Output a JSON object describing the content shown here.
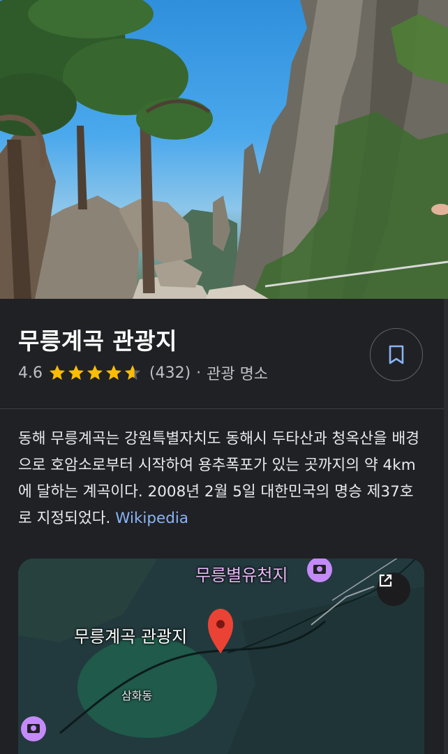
{
  "place": {
    "title": "무릉계곡 관광지",
    "rating": "4.6",
    "rating_value": 4.6,
    "review_count": "(432)",
    "separator": "·",
    "category": "관광 명소"
  },
  "description": {
    "text": "동해 무릉계곡는 강원특별자치도 동해시 두타산과 청옥산을 배경으로 호암소로부터 시작하여 용추폭포가 있는 곳까지의 약 4km에 달하는 계곡이다. 2008년 2월 5일 대한민국의 명승 제37호로 지정되었다. ",
    "link_label": "Wikipedia"
  },
  "map": {
    "place_label": "무릉계곡 관광지",
    "poi_label": "무릉별유천지",
    "district_label": "삼화동"
  },
  "icons": {
    "save": "bookmark-icon",
    "expand": "open-in-new-icon",
    "pin": "map-pin-icon",
    "poi": "camera-icon"
  },
  "colors": {
    "background": "#202124",
    "accent_link": "#8ab4f8",
    "star": "#fbbc04",
    "pin": "#ea4335",
    "poi_pin": "#c58af9",
    "map_area": "#1f5a4a"
  }
}
